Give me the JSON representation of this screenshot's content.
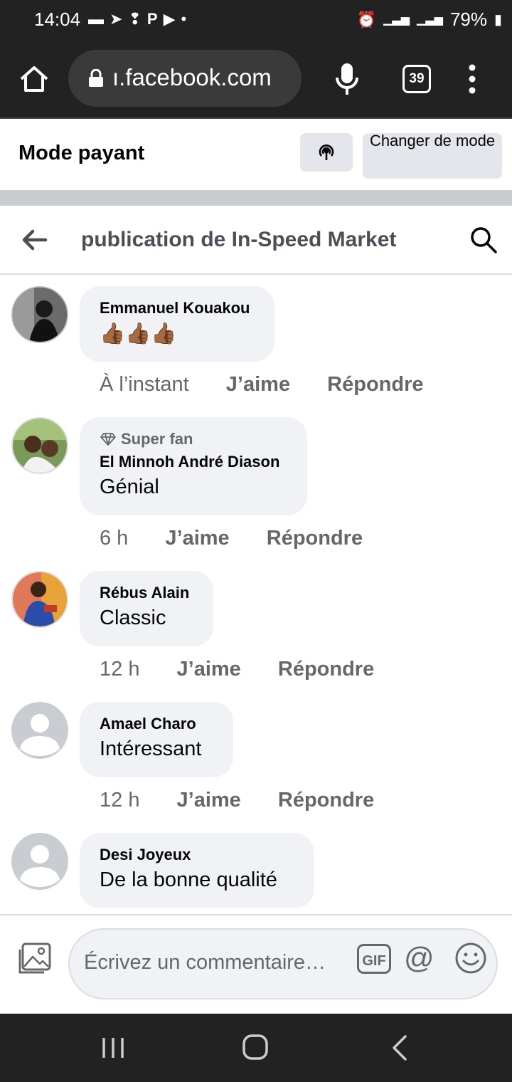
{
  "status_bar": {
    "time": "14:04",
    "battery": "79%"
  },
  "browser": {
    "url": "ı.facebook.com",
    "tab_count": "39"
  },
  "mode_header": {
    "title": "Mode payant",
    "change_mode_label": "Changer de mode"
  },
  "page_header": {
    "title": "publication de In-Speed Market"
  },
  "comments": [
    {
      "author": "Emmanuel Kouakou",
      "text": "👍🏾👍🏾👍🏾",
      "time": "À l’instant",
      "like_label": "J’aime",
      "reply_label": "Répondre",
      "avatar": "photo-dark"
    },
    {
      "badge": "Super fan",
      "author": "El Minnoh André Diason",
      "text": "Génial",
      "time": "6 h",
      "like_label": "J’aime",
      "reply_label": "Répondre",
      "avatar": "photo-couple"
    },
    {
      "author": "Rébus Alain",
      "text": "Classic",
      "time": "12 h",
      "like_label": "J’aime",
      "reply_label": "Répondre",
      "avatar": "photo-colorful"
    },
    {
      "author": "Amael Charo",
      "text": "Intéressant",
      "time": "12 h",
      "like_label": "J’aime",
      "reply_label": "Répondre",
      "avatar": "default-avatar"
    },
    {
      "author": "Desi Joyeux",
      "text": "De la bonne qualité",
      "avatar": "default-avatar"
    }
  ],
  "composer": {
    "placeholder": "Écrivez un commentaire…",
    "gif_label": "GIF",
    "at_label": "@"
  },
  "colors": {
    "system_bar": "#222222",
    "bubble": "#f0f2f5",
    "secondary_text": "#65676b",
    "button_gray": "#e4e6eb"
  }
}
